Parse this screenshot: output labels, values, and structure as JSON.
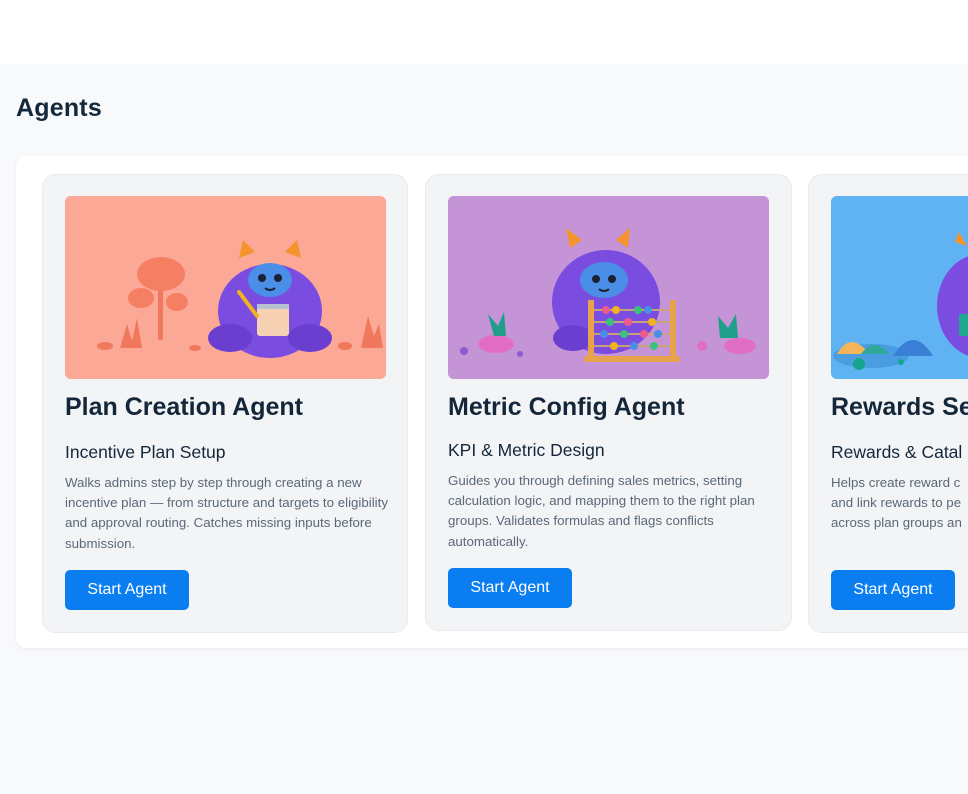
{
  "page": {
    "title": "Agents"
  },
  "colors": {
    "accent": "#0a7ef0",
    "card1_art": "#fca896",
    "card2_art": "#c594d6",
    "card3_art": "#5fb3f2",
    "mascot": "#7a4ce0"
  },
  "agents": [
    {
      "title": "Plan Creation Agent",
      "subtitle": "Incentive Plan Setup",
      "description": "Walks admins step by step through creating a new incentive plan — from structure and targets to eligibility and approval routing. Catches missing inputs before submission.",
      "button_label": "Start Agent",
      "illustration": "mascot-with-notepad"
    },
    {
      "title": "Metric Config Agent",
      "subtitle": "KPI & Metric Design",
      "description": "Guides you through defining sales metrics, setting calculation logic, and mapping them to the right plan groups. Validates formulas and flags conflicts automatically.",
      "button_label": "Start Agent",
      "illustration": "mascot-with-abacus"
    },
    {
      "title": "Rewards Se",
      "subtitle": "Rewards & Catal",
      "description_lines": [
        "Helps create reward c",
        "and link rewards to pe",
        "across plan groups an"
      ],
      "button_label": "Start Agent",
      "illustration": "mascot-with-gift"
    }
  ]
}
